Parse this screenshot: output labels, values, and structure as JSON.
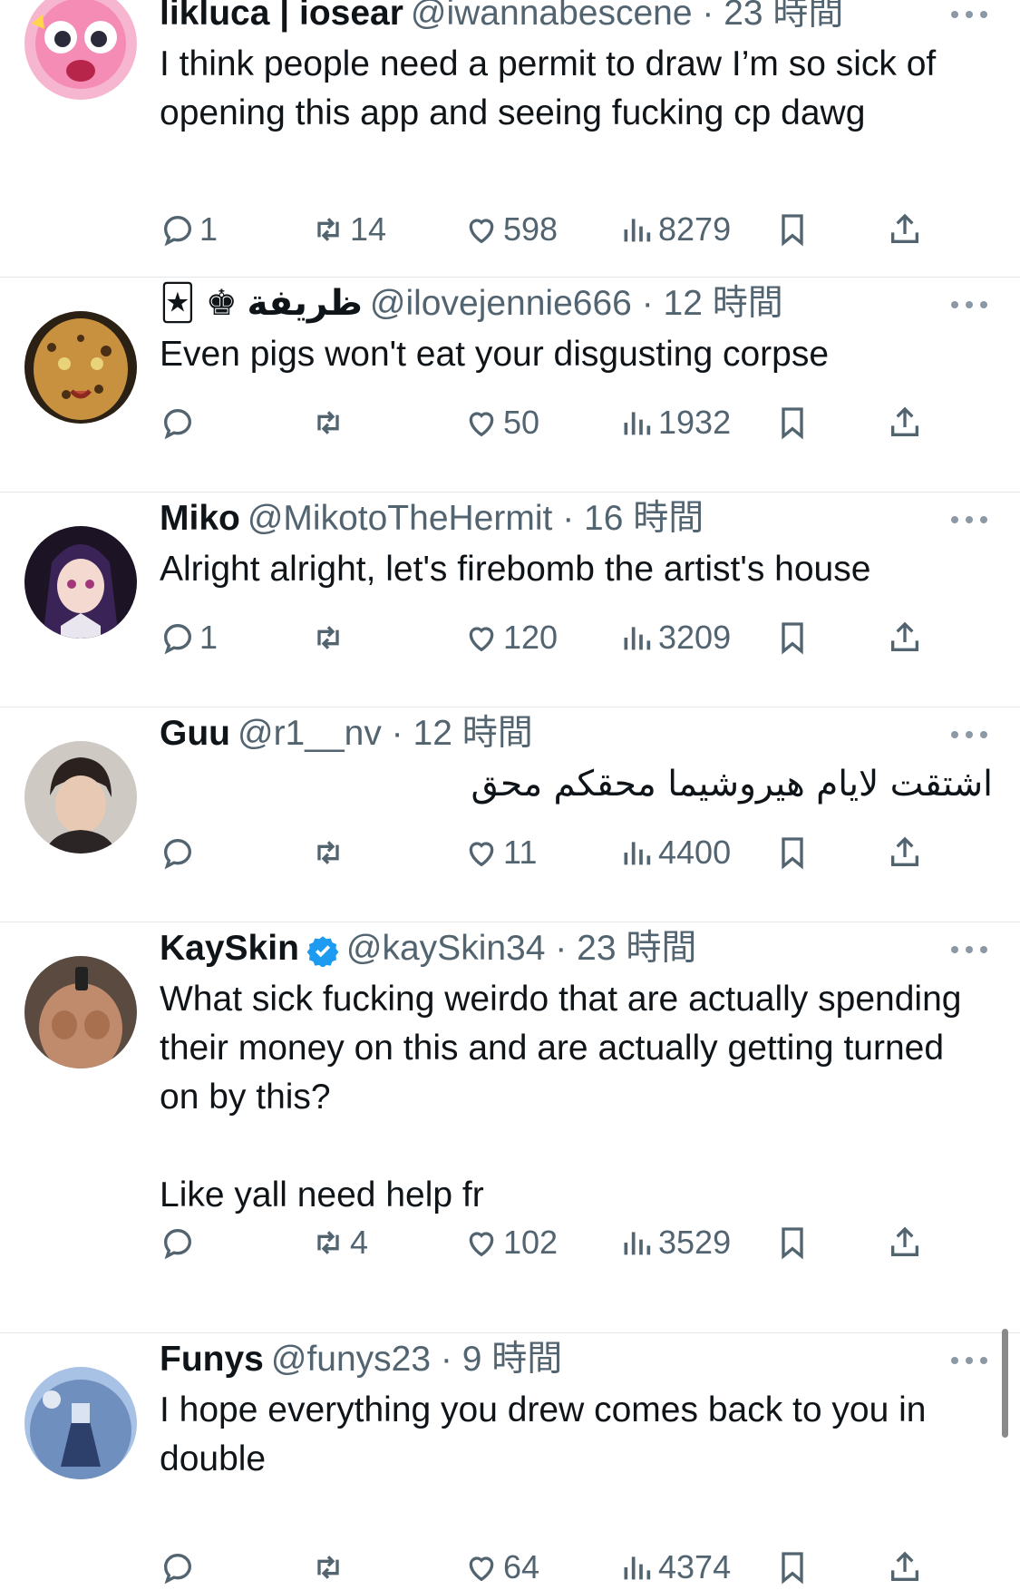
{
  "tweets": [
    {
      "name": "likluca | iosear",
      "handle": "@iwannabescene",
      "sep": "·",
      "time": "23 時間",
      "text": "I think people need a permit to draw I’m so sick of opening this app and seeing fucking cp dawg",
      "replies": "1",
      "retweets": "14",
      "likes": "598",
      "views": "8279",
      "avatar_color": "#f06aa0"
    },
    {
      "name": "🃏 ♚ ظريفة",
      "handle": "@ilovejennie666",
      "sep": "·",
      "time": "12 時間",
      "text": "Even pigs won't eat your disgusting corpse",
      "replies": "",
      "retweets": "",
      "likes": "50",
      "views": "1932",
      "avatar_color": "#c08a3e"
    },
    {
      "name": "Miko",
      "handle": "@MikotoTheHermit",
      "sep": "·",
      "time": "16 時間",
      "text": "Alright alright, let's firebomb the artist's house",
      "replies": "1",
      "retweets": "",
      "likes": "120",
      "views": "3209",
      "avatar_color": "#3b2a4a"
    },
    {
      "name": "Guu",
      "handle": "@r1__nv",
      "sep": "·",
      "time": "12 時間",
      "text": "اشتقت لايام هيروشيما محقكم محق",
      "replies": "",
      "retweets": "",
      "likes": "11",
      "views": "4400",
      "avatar_color": "#6b5a52"
    },
    {
      "name": "KaySkin",
      "handle": "@kaySkin34",
      "sep": "·",
      "time": "23 時間",
      "text": "What sick fucking weirdo that are actually spending their money on this and are actually getting turned on by this?\n\nLike yall need help fr",
      "replies": "",
      "retweets": "4",
      "likes": "102",
      "views": "3529",
      "avatar_color": "#8a6a55"
    },
    {
      "name": "Funys",
      "handle": "@funys23",
      "sep": "·",
      "time": "9 時間",
      "text": "I hope everything you drew comes back to you in double",
      "replies": "",
      "retweets": "",
      "likes": "64",
      "views": "4374",
      "avatar_color": "#7f9cc9"
    }
  ],
  "colors": {
    "text": "#0f1419",
    "secondary": "#536471",
    "divider": "#e6e9ec",
    "verified": "#1d9bf0"
  },
  "icons": [
    "reply-icon",
    "retweet-icon",
    "like-icon",
    "views-icon",
    "bookmark-icon",
    "share-icon",
    "more-icon",
    "verified-badge-icon"
  ]
}
